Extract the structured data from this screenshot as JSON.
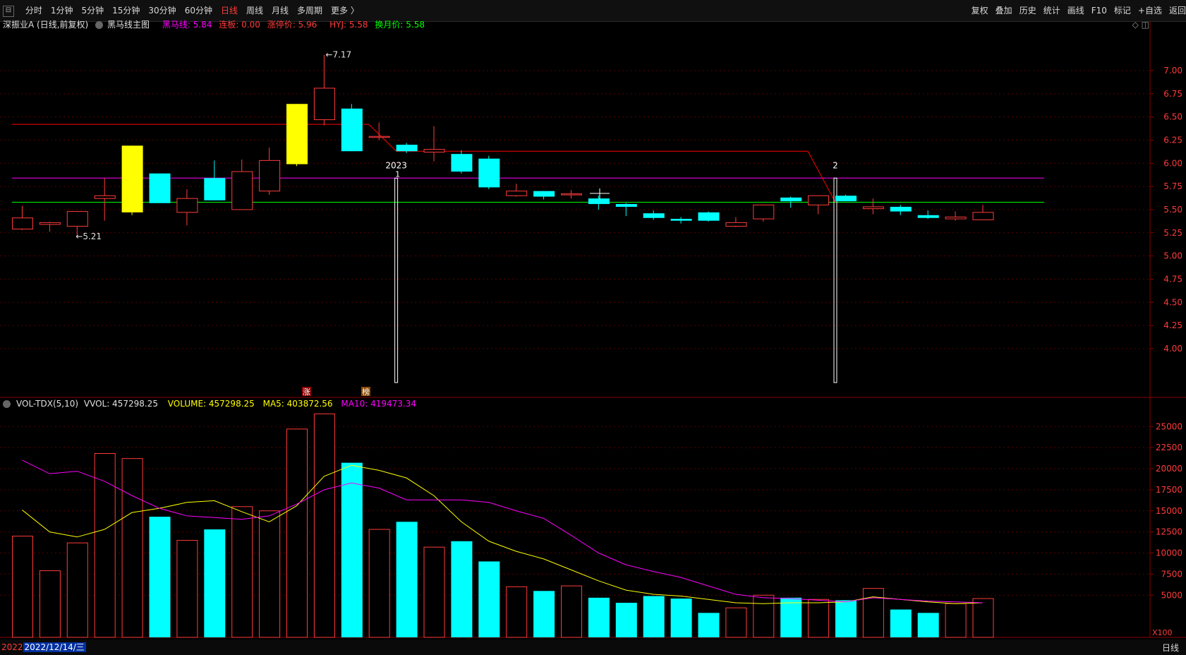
{
  "toolbar": {
    "collapse_icon": "collapse-icon",
    "left_items": [
      "分时",
      "1分钟",
      "5分钟",
      "15分钟",
      "30分钟",
      "60分钟",
      "日线",
      "周线",
      "月线",
      "多周期",
      "更多 〉"
    ],
    "active_item": "日线",
    "right_items": [
      "复权",
      "叠加",
      "历史",
      "统计",
      "画线",
      "F10",
      "标记",
      "+自选",
      "返回"
    ]
  },
  "info": {
    "stock": "深振业A (日线,前复权)",
    "indicator": "黑马线主图",
    "heima": "黑马线: 5.84",
    "lianban": "连板: 0.00",
    "zhangting": "涨停价: 5.96",
    "hyj": "HYJ: 5.58",
    "huanyue": "换月价: 5.58"
  },
  "colors": {
    "up": "#ff3b3b",
    "down": "#00ffff",
    "limit_up": "#ffff00",
    "heima_line": "#ff00ff",
    "hyj_line": "#00ff00",
    "resistance_line": "#ff0000",
    "ma5": "#ffff00",
    "ma10": "#ff00ff",
    "grid": "#5a0000",
    "axis_text": "#ff3b3b"
  },
  "vol_info": {
    "title": "VOL-TDX(5,10)",
    "vvol": "VVOL: 457298.25",
    "volume": "VOLUME: 457298.25",
    "ma5": "MA5: 403872.56",
    "ma10": "MA10: 419473.34"
  },
  "markers": {
    "zhang": "涨",
    "bang": "榜",
    "year_label": "2023",
    "month_label_1": "1",
    "month_label_2": "2",
    "high_label": "7.17",
    "low_label": "5.21",
    "x100": "X100",
    "date_prefix": "2022",
    "date_selected": "2022/12/14/三",
    "period": "日线"
  },
  "chart_data": [
    {
      "type": "candlestick",
      "title": "",
      "ylim": [
        3.6,
        7.4
      ],
      "yticks": [
        4.0,
        4.25,
        4.5,
        4.75,
        5.0,
        5.25,
        5.5,
        5.75,
        6.0,
        6.25,
        6.5,
        6.75,
        7.0
      ],
      "horizontal_lines": [
        {
          "name": "黑马线",
          "value": 5.84,
          "color": "#ff00ff"
        },
        {
          "name": "HYJ",
          "value": 5.58,
          "color": "#00ff00"
        }
      ],
      "candles": [
        {
          "o": 5.29,
          "h": 5.54,
          "l": 5.28,
          "c": 5.41,
          "kind": "up"
        },
        {
          "o": 5.34,
          "h": 5.37,
          "l": 5.26,
          "c": 5.36,
          "kind": "up"
        },
        {
          "o": 5.32,
          "h": 5.48,
          "l": 5.21,
          "c": 5.48,
          "kind": "up"
        },
        {
          "o": 5.62,
          "h": 5.84,
          "l": 5.38,
          "c": 5.65,
          "kind": "up"
        },
        {
          "o": 5.47,
          "h": 6.19,
          "l": 5.44,
          "c": 6.19,
          "kind": "limit"
        },
        {
          "o": 5.89,
          "h": 5.89,
          "l": 5.57,
          "c": 5.57,
          "kind": "down"
        },
        {
          "o": 5.47,
          "h": 5.72,
          "l": 5.33,
          "c": 5.62,
          "kind": "up"
        },
        {
          "o": 5.84,
          "h": 6.03,
          "l": 5.6,
          "c": 5.6,
          "kind": "down"
        },
        {
          "o": 5.5,
          "h": 6.04,
          "l": 5.5,
          "c": 5.91,
          "kind": "up"
        },
        {
          "o": 5.7,
          "h": 6.17,
          "l": 5.66,
          "c": 6.03,
          "kind": "up"
        },
        {
          "o": 5.99,
          "h": 6.64,
          "l": 5.97,
          "c": 6.64,
          "kind": "limit"
        },
        {
          "o": 6.47,
          "h": 7.17,
          "l": 6.41,
          "c": 6.81,
          "kind": "up"
        },
        {
          "o": 6.59,
          "h": 6.64,
          "l": 6.13,
          "c": 6.13,
          "kind": "down"
        },
        {
          "o": 6.29,
          "h": 6.44,
          "l": 6.25,
          "c": 6.29,
          "kind": "up"
        },
        {
          "o": 6.2,
          "h": 6.22,
          "l": 6.11,
          "c": 6.13,
          "kind": "down"
        },
        {
          "o": 6.12,
          "h": 6.4,
          "l": 6.02,
          "c": 6.15,
          "kind": "up"
        },
        {
          "o": 6.1,
          "h": 6.14,
          "l": 5.89,
          "c": 5.91,
          "kind": "down"
        },
        {
          "o": 6.05,
          "h": 6.08,
          "l": 5.72,
          "c": 5.74,
          "kind": "down"
        },
        {
          "o": 5.65,
          "h": 5.78,
          "l": 5.64,
          "c": 5.7,
          "kind": "up"
        },
        {
          "o": 5.7,
          "h": 5.7,
          "l": 5.61,
          "c": 5.64,
          "kind": "down"
        },
        {
          "o": 5.67,
          "h": 5.71,
          "l": 5.62,
          "c": 5.67,
          "kind": "up"
        },
        {
          "o": 5.62,
          "h": 5.65,
          "l": 5.5,
          "c": 5.56,
          "kind": "down"
        },
        {
          "o": 5.56,
          "h": 5.57,
          "l": 5.43,
          "c": 5.53,
          "kind": "down"
        },
        {
          "o": 5.46,
          "h": 5.49,
          "l": 5.39,
          "c": 5.41,
          "kind": "down"
        },
        {
          "o": 5.4,
          "h": 5.42,
          "l": 5.35,
          "c": 5.38,
          "kind": "down"
        },
        {
          "o": 5.47,
          "h": 5.48,
          "l": 5.37,
          "c": 5.38,
          "kind": "down"
        },
        {
          "o": 5.32,
          "h": 5.42,
          "l": 5.31,
          "c": 5.36,
          "kind": "up"
        },
        {
          "o": 5.4,
          "h": 5.55,
          "l": 5.37,
          "c": 5.55,
          "kind": "up"
        },
        {
          "o": 5.63,
          "h": 5.64,
          "l": 5.52,
          "c": 5.59,
          "kind": "down"
        },
        {
          "o": 5.55,
          "h": 5.65,
          "l": 5.45,
          "c": 5.65,
          "kind": "up"
        },
        {
          "o": 5.65,
          "h": 5.66,
          "l": 5.59,
          "c": 5.59,
          "kind": "down"
        },
        {
          "o": 5.51,
          "h": 5.62,
          "l": 5.45,
          "c": 5.53,
          "kind": "up"
        },
        {
          "o": 5.53,
          "h": 5.55,
          "l": 5.44,
          "c": 5.48,
          "kind": "down"
        },
        {
          "o": 5.44,
          "h": 5.49,
          "l": 5.4,
          "c": 5.41,
          "kind": "down"
        },
        {
          "o": 5.4,
          "h": 5.48,
          "l": 5.38,
          "c": 5.42,
          "kind": "up"
        },
        {
          "o": 5.39,
          "h": 5.55,
          "l": 5.39,
          "c": 5.47,
          "kind": "up"
        }
      ],
      "resistance_line": [
        [
          0,
          6.42
        ],
        [
          13,
          6.42
        ],
        [
          14,
          6.13
        ],
        [
          29,
          6.13
        ],
        [
          30,
          5.58
        ]
      ]
    },
    {
      "type": "bar",
      "title": "VOL-TDX(5,10)",
      "unit": "X100",
      "ylim": [
        0,
        28000
      ],
      "yticks": [
        5000,
        7500,
        10000,
        12500,
        15000,
        17500,
        20000,
        22500,
        25000
      ],
      "series": [
        {
          "name": "VOLUME",
          "values": [
            12000,
            7900,
            11200,
            21800,
            21200,
            14300,
            11500,
            12800,
            15500,
            15000,
            24700,
            26500,
            20700,
            12800,
            13700,
            10700,
            11400,
            9000,
            6000,
            5500,
            6100,
            4700,
            4100,
            4900,
            4600,
            2900,
            3500,
            5000,
            4700,
            4500,
            4400,
            5800,
            3300,
            2900,
            4000,
            4600
          ]
        },
        {
          "name": "MA5",
          "values": [
            15100,
            12500,
            11900,
            12800,
            14800,
            15300,
            16000,
            16200,
            14900,
            13700,
            15600,
            19100,
            20400,
            19800,
            18900,
            16800,
            13700,
            11400,
            10200,
            9300,
            8000,
            6700,
            5600,
            5100,
            4900,
            4500,
            4100,
            4000,
            4100,
            4100,
            4200,
            4800,
            4500,
            4200,
            4000,
            4100
          ]
        },
        {
          "name": "MA10",
          "values": [
            21000,
            19400,
            19700,
            18500,
            16800,
            15300,
            14400,
            14200,
            14000,
            14400,
            15800,
            17500,
            18300,
            17700,
            16300,
            16300,
            16300,
            16000,
            15000,
            14100,
            12100,
            10000,
            8600,
            7800,
            7100,
            6100,
            5100,
            4700,
            4600,
            4400,
            4200,
            4700,
            4500,
            4300,
            4200,
            4100
          ]
        }
      ]
    }
  ]
}
